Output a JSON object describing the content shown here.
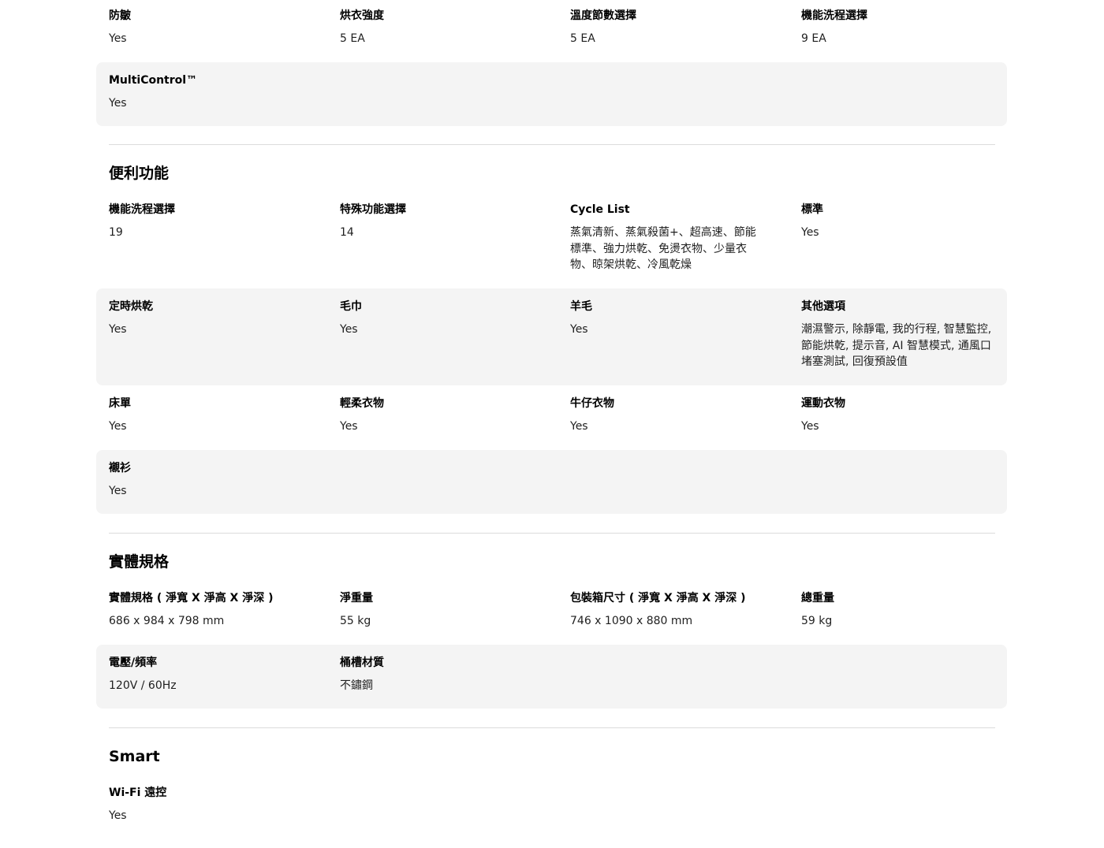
{
  "sections": [
    {
      "rows": [
        {
          "cells": [
            {
              "label": "防皺",
              "value": "Yes"
            },
            {
              "label": "烘衣強度",
              "value": "5 EA"
            },
            {
              "label": "溫度節數選擇",
              "value": "5 EA"
            },
            {
              "label": "機能洗程選擇",
              "value": "9 EA"
            }
          ]
        },
        {
          "cells": [
            {
              "label": "MultiControl™",
              "value": "Yes"
            }
          ]
        }
      ]
    },
    {
      "title": "便利功能",
      "rows": [
        {
          "cells": [
            {
              "label": "機能洗程選擇",
              "value": "19"
            },
            {
              "label": "特殊功能選擇",
              "value": "14"
            },
            {
              "label": "Cycle List",
              "value": "蒸氣清新、蒸氣殺菌+、超高速、節能標準、強力烘乾、免燙衣物、少量衣物、晾架烘乾、冷風乾燥"
            },
            {
              "label": "標準",
              "value": "Yes"
            }
          ]
        },
        {
          "cells": [
            {
              "label": "定時烘乾",
              "value": "Yes"
            },
            {
              "label": "毛巾",
              "value": "Yes"
            },
            {
              "label": "羊毛",
              "value": "Yes"
            },
            {
              "label": "其他選項",
              "value": "潮濕警示, 除靜電, 我的行程, 智慧監控, 節能烘乾, 提示音, AI 智慧模式, 通風口堵塞測試, 回復預設值"
            }
          ]
        },
        {
          "cells": [
            {
              "label": "床單",
              "value": "Yes"
            },
            {
              "label": "輕柔衣物",
              "value": "Yes"
            },
            {
              "label": "牛仔衣物",
              "value": "Yes"
            },
            {
              "label": "運動衣物",
              "value": "Yes"
            }
          ]
        },
        {
          "cells": [
            {
              "label": "襯衫",
              "value": "Yes"
            }
          ]
        }
      ]
    },
    {
      "title": "實體規格",
      "rows": [
        {
          "cells": [
            {
              "label": "實體規格 ( 淨寬 X 淨高 X 淨深 )",
              "value": "686 x 984 x 798 mm"
            },
            {
              "label": "淨重量",
              "value": "55 kg"
            },
            {
              "label": "包裝箱尺寸 ( 淨寬 X 淨高 X 淨深 )",
              "value": "746 x 1090 x 880 mm"
            },
            {
              "label": "總重量",
              "value": "59 kg"
            }
          ]
        },
        {
          "cells": [
            {
              "label": "電壓/頻率",
              "value": "120V / 60Hz"
            },
            {
              "label": "桶槽材質",
              "value": "不鏽鋼"
            }
          ]
        }
      ]
    },
    {
      "title": "Smart",
      "rows": [
        {
          "cells": [
            {
              "label": "Wi-Fi 遠控",
              "value": "Yes"
            }
          ]
        }
      ]
    }
  ]
}
